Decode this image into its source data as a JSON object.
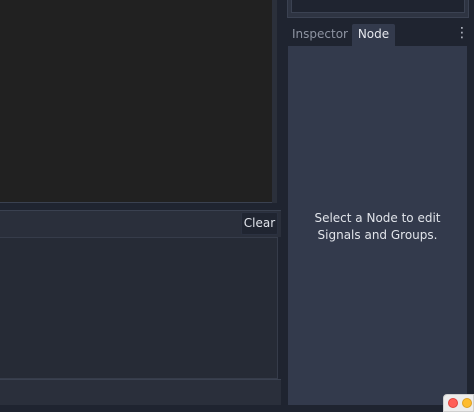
{
  "output": {
    "clear_label": "Clear"
  },
  "dock": {
    "tabs": [
      {
        "label": "Inspector",
        "active": false
      },
      {
        "label": "Node",
        "active": true
      }
    ],
    "menu_icon": "⋮",
    "node_message": "Select a Node to edit Signals and Groups."
  },
  "colors": {
    "panel_bg": "#333a4c",
    "base_bg": "#1f2430",
    "viewport_bg": "#212121"
  }
}
